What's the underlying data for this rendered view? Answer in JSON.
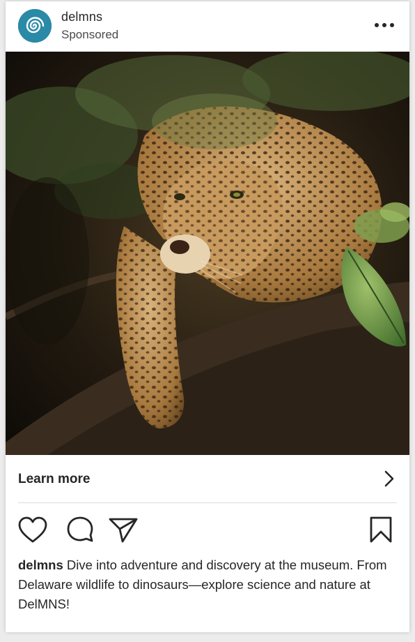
{
  "post": {
    "username": "delmns",
    "sponsored_label": "Sponsored",
    "image_subject": "jaguar",
    "cta_label": "Learn more",
    "caption_user": "delmns",
    "caption_text": "Dive into adventure and discovery at the museum. From Delaware wildlife to dinosaurs—explore science and nature at DelMNS!"
  },
  "icons": {
    "more": "more-horizontal-icon",
    "chevron": "chevron-right-icon",
    "like": "heart-icon",
    "comment": "comment-bubble-icon",
    "share": "paper-plane-icon",
    "save": "bookmark-icon"
  },
  "colors": {
    "text": "#262626",
    "divider": "#dbdbdb",
    "avatar": "#2a8aa8"
  }
}
